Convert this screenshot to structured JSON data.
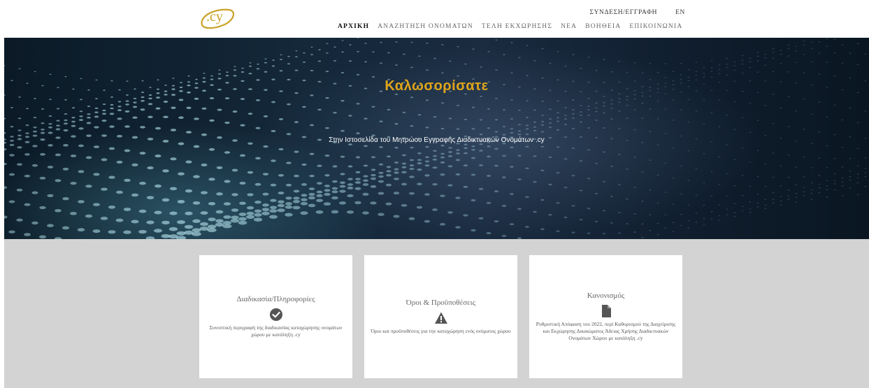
{
  "header": {
    "logo_text": ".cy",
    "top_links": {
      "login": "ΣΥΝΔΕΣΗ/ΕΓΓΡΑΦΗ",
      "lang": "EN"
    },
    "nav": [
      {
        "label": "ΑΡΧΙΚΗ"
      },
      {
        "label": "ΑΝΑΖΗΤΗΣΗ ΟΝΟΜΑΤΩΝ"
      },
      {
        "label": "ΤΕΛΗ ΕΚΧΩΡΗΣΗΣ"
      },
      {
        "label": "ΝΕΑ"
      },
      {
        "label": "ΒΟΗΘΕΙΑ"
      },
      {
        "label": "ΕΠΙΚΟΙΝΩΝΙΑ"
      }
    ]
  },
  "hero": {
    "title": "Καλωσορίσατε",
    "subtitle": "Στην Ιστοσελίδα του Μητρώου Εγγραφής Διαδικτυακών Ονομάτων .cy"
  },
  "cards": [
    {
      "title": "Διαδικασία/Πληροφορίες",
      "icon": "check-circle-icon",
      "description": "Συνοπτική περιγραφή της διαδικασίας καταχώρησης ονομάτων χώρου με κατάληξη .cy"
    },
    {
      "title": "Όροι & Προϋποθέσεις",
      "icon": "warning-icon",
      "description": "Όροι και προϋποθέσεις για την καταχώρηση ενός ονόματος χώρου"
    },
    {
      "title": "Κανονισμός",
      "icon": "document-icon",
      "description": "Ρυθμιστική Απόφαση του 2022, περί Καθορισμού της Διαχείρισης και Εκχώρησης Δικαιώματος Άδειας Χρήσης Διαδικτυακών Ονομάτων Χώρου με κατάληξη .cy"
    }
  ],
  "colors": {
    "accent_gold": "#e0a51a",
    "logo_gold": "#c9a227",
    "cards_bg": "#d3d3d3",
    "hero_dark": "#14283a"
  }
}
